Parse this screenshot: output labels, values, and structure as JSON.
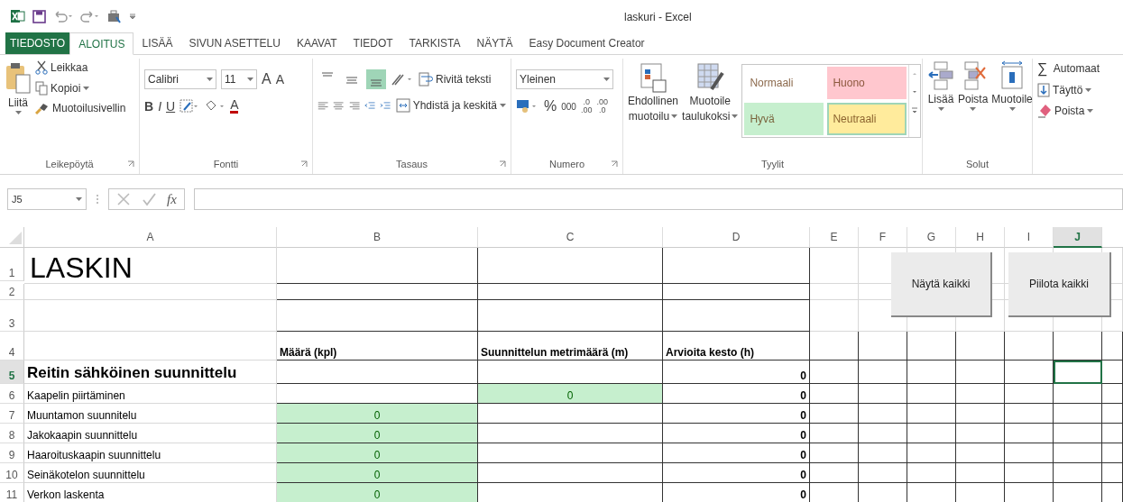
{
  "window": {
    "title": "laskuri - Excel"
  },
  "tabs": [
    {
      "label": "TIEDOSTO",
      "kind": "file",
      "selected": false
    },
    {
      "label": "ALOITUS",
      "kind": "tab",
      "selected": true
    },
    {
      "label": "LISÄÄ",
      "kind": "tab",
      "selected": false
    },
    {
      "label": "SIVUN ASETTELU",
      "kind": "tab",
      "selected": false
    },
    {
      "label": "KAAVAT",
      "kind": "tab",
      "selected": false
    },
    {
      "label": "TIEDOT",
      "kind": "tab",
      "selected": false
    },
    {
      "label": "TARKISTA",
      "kind": "tab",
      "selected": false
    },
    {
      "label": "NÄYTÄ",
      "kind": "tab",
      "selected": false
    },
    {
      "label": "Easy Document Creator",
      "kind": "tab",
      "selected": false
    }
  ],
  "clipboard": {
    "paste": "Liitä",
    "cut": "Leikkaa",
    "copy": "Kopioi",
    "painter": "Muotoilusivellin",
    "label": "Leikepöytä"
  },
  "font": {
    "name": "Calibri",
    "size": "11",
    "grow": "A",
    "shrink": "A",
    "bold": "B",
    "italic": "I",
    "underline": "U",
    "color_letter": "A",
    "label": "Fontti"
  },
  "alignment": {
    "vertical": [
      {
        "selected": false
      },
      {
        "selected": false
      },
      {
        "selected": true
      }
    ],
    "wrap": "Rivitä teksti",
    "merge": "Yhdistä ja keskitä",
    "label": "Tasaus"
  },
  "number": {
    "format": "Yleinen",
    "percent": "%",
    "thousands": "000",
    "decimals": [
      {
        "top": ".0",
        "bottom": ".00"
      },
      {
        "top": ".00",
        "bottom": ".0"
      }
    ],
    "label": "Numero"
  },
  "styles": {
    "conditional": [
      "Ehdollinen",
      "muotoilu"
    ],
    "as_table": [
      "Muotoile",
      "taulukoksi"
    ],
    "gallery": [
      {
        "label": "Normaali",
        "color": "#ffffff",
        "selected": false
      },
      {
        "label": "Huono",
        "color": "#ffc7ce",
        "selected": false
      },
      {
        "label": "Hyvä",
        "color": "#c6efce",
        "selected": false
      },
      {
        "label": "Neutraali",
        "color": "#ffeb9c",
        "selected": true
      }
    ],
    "label": "Tyylit"
  },
  "cells_group": {
    "insert": "Lisää",
    "delete": "Poista",
    "format": "Muotoile",
    "label": "Solut"
  },
  "editing": {
    "sum_symbol": "∑",
    "autosum": "Automaat",
    "fill": "Täyttö",
    "clear": "Poista"
  },
  "formula_bar": {
    "name_box": "J5",
    "fx": "fx"
  },
  "columns": [
    {
      "label": "A",
      "selected": false
    },
    {
      "label": "B",
      "selected": false
    },
    {
      "label": "C",
      "selected": false
    },
    {
      "label": "D",
      "selected": false
    },
    {
      "label": "E",
      "selected": false
    },
    {
      "label": "F",
      "selected": false
    },
    {
      "label": "G",
      "selected": false
    },
    {
      "label": "H",
      "selected": false
    },
    {
      "label": "I",
      "selected": false
    },
    {
      "label": "J",
      "selected": true
    }
  ],
  "rows": [
    {
      "number": "1",
      "selected": false,
      "cells": [
        {
          "text": "LASKIN",
          "kind": "title"
        },
        {
          "kind": "plain"
        },
        {
          "kind": "plain"
        },
        {
          "kind": "plain"
        }
      ]
    },
    {
      "number": "2",
      "selected": false,
      "cells": [
        {
          "kind": "plain"
        },
        {
          "kind": "plain"
        },
        {
          "kind": "plain"
        },
        {
          "kind": "plain"
        }
      ]
    },
    {
      "number": "3",
      "selected": false,
      "cells": [
        {
          "kind": "plain"
        },
        {
          "kind": "plain"
        },
        {
          "kind": "plain"
        },
        {
          "kind": "plain"
        }
      ]
    },
    {
      "number": "4",
      "selected": false,
      "cells": [
        {
          "kind": "plain"
        },
        {
          "text": "Määrä (kpl)",
          "kind": "heading"
        },
        {
          "text": "Suunnittelun metrimäärä (m)",
          "kind": "heading"
        },
        {
          "text": "Arvioita kesto (h)",
          "kind": "heading"
        }
      ]
    },
    {
      "number": "5",
      "selected": true,
      "cells": [
        {
          "text": "Reitin sähköinen suunnittelu",
          "kind": "section"
        },
        {
          "kind": "plain"
        },
        {
          "kind": "plain"
        },
        {
          "text": "0",
          "kind": "total"
        }
      ]
    },
    {
      "number": "6",
      "selected": false,
      "cells": [
        {
          "text": "Kaapelin piirtäminen",
          "kind": "plain"
        },
        {
          "kind": "plain"
        },
        {
          "text": "0",
          "kind": "input"
        },
        {
          "text": "0",
          "kind": "total"
        }
      ]
    },
    {
      "number": "7",
      "selected": false,
      "cells": [
        {
          "text": "Muuntamon suunnitelu",
          "kind": "plain"
        },
        {
          "text": "0",
          "kind": "input"
        },
        {
          "kind": "plain"
        },
        {
          "text": "0",
          "kind": "total"
        }
      ]
    },
    {
      "number": "8",
      "selected": false,
      "cells": [
        {
          "text": "Jakokaapin suunnittelu",
          "kind": "plain"
        },
        {
          "text": "0",
          "kind": "input"
        },
        {
          "kind": "plain"
        },
        {
          "text": "0",
          "kind": "total"
        }
      ]
    },
    {
      "number": "9",
      "selected": false,
      "cells": [
        {
          "text": "Haaroituskaapin suunnittelu",
          "kind": "plain"
        },
        {
          "text": "0",
          "kind": "input"
        },
        {
          "kind": "plain"
        },
        {
          "text": "0",
          "kind": "total"
        }
      ]
    },
    {
      "number": "10",
      "selected": false,
      "cells": [
        {
          "text": "Seinäkotelon suunnittelu",
          "kind": "plain"
        },
        {
          "text": "0",
          "kind": "input"
        },
        {
          "kind": "plain"
        },
        {
          "text": "0",
          "kind": "total"
        }
      ]
    },
    {
      "number": "11",
      "selected": false,
      "cells": [
        {
          "text": "Verkon laskenta",
          "kind": "plain"
        },
        {
          "text": "0",
          "kind": "input"
        },
        {
          "kind": "plain"
        },
        {
          "text": "0",
          "kind": "total"
        }
      ]
    }
  ],
  "sheet_buttons": [
    {
      "label": "Näytä kaikki"
    },
    {
      "label": "Piilota kaikki"
    }
  ]
}
